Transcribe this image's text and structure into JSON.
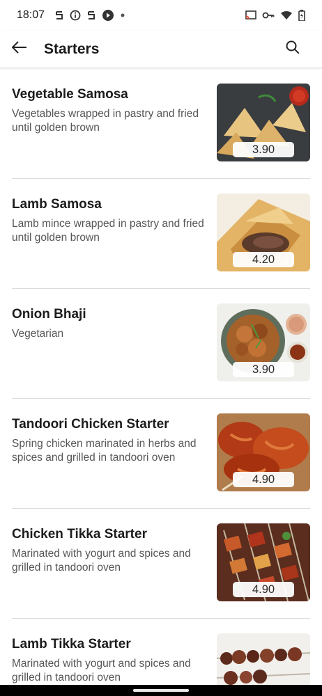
{
  "status_bar": {
    "time": "18:07"
  },
  "header": {
    "title": "Starters"
  },
  "items": [
    {
      "name": "Vegetable Samosa",
      "description": "Vegetables wrapped in pastry and fried until golden brown",
      "price": "3.90"
    },
    {
      "name": "Lamb Samosa",
      "description": "Lamb mince wrapped in pastry and fried until golden brown",
      "price": "4.20"
    },
    {
      "name": "Onion Bhaji",
      "description": "Vegetarian",
      "price": "3.90"
    },
    {
      "name": "Tandoori Chicken Starter",
      "description": "Spring chicken marinated in herbs and spices and grilled in tandoori oven",
      "price": "4.90"
    },
    {
      "name": "Chicken Tikka Starter",
      "description": "Marinated with yogurt and spices and grilled in tandoori oven",
      "price": "4.90"
    },
    {
      "name": "Lamb Tikka Starter",
      "description": "Marinated with yogurt and spices and grilled in tandoori oven",
      "price": ""
    }
  ],
  "icons": {
    "back": "arrow-left-icon",
    "search": "search-icon"
  }
}
